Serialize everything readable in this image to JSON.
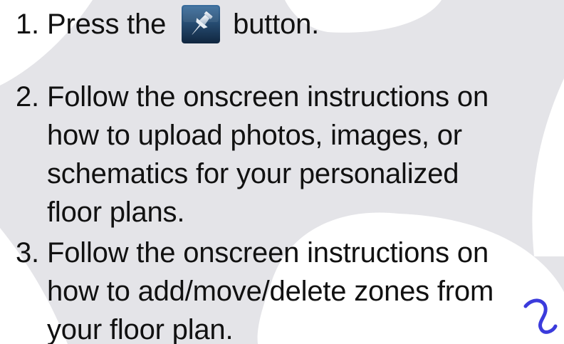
{
  "steps": [
    {
      "number": "1.",
      "lines": [
        "Press the",
        "button."
      ],
      "icon": "push-pin-icon"
    },
    {
      "number": "2.",
      "lines": [
        "Follow the onscreen instructions on",
        "how to upload photos, images, or",
        "schematics for your personalized",
        "floor plans."
      ]
    },
    {
      "number": "3.",
      "lines": [
        "Follow the onscreen instructions on",
        "how to add/move/delete zones from",
        "your floor plan."
      ]
    }
  ],
  "colors": {
    "background_shape": "#e4e4e8",
    "text": "#111111",
    "icon_bg_top": "#3a6e9e",
    "icon_bg_bottom": "#10263f",
    "accent_stroke": "#3b3bdc"
  }
}
